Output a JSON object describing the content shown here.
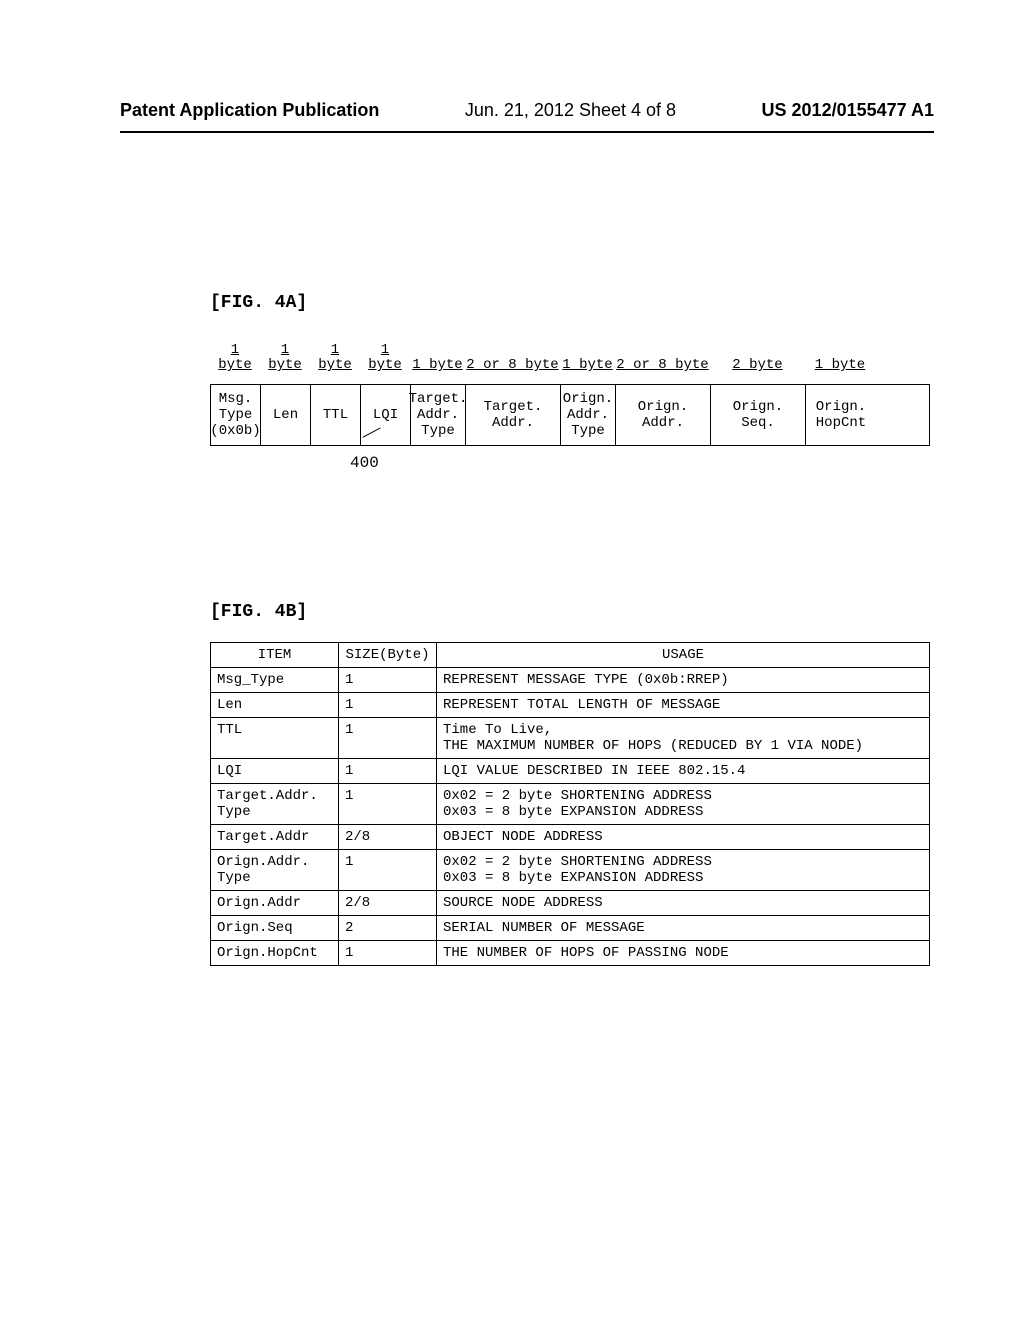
{
  "header": {
    "left": "Patent Application Publication",
    "center": "Jun. 21, 2012  Sheet 4 of 8",
    "right": "US 2012/0155477 A1"
  },
  "fig4a": {
    "label": "[FIG. 4A]",
    "byte_widths": [
      "1 byte",
      "1 byte",
      "1 byte",
      "1 byte",
      "1 byte",
      "2 or 8 byte",
      "1 byte",
      "2 or 8 byte",
      "2 byte",
      "1 byte"
    ],
    "fields": [
      "Msg.\nType\n(0x0b)",
      "Len",
      "TTL",
      "LQI",
      "Target.\nAddr.\nType",
      "Target.\nAddr.",
      "Orign.\nAddr.\nType",
      "Orign.\nAddr.",
      "Orign.\nSeq.",
      "Orign.\nHopCnt"
    ],
    "ref": "400"
  },
  "fig4b": {
    "label": "[FIG. 4B]",
    "headers": [
      "ITEM",
      "SIZE(Byte)",
      "USAGE"
    ],
    "rows": [
      {
        "item": "Msg_Type",
        "size": "1",
        "usage": "REPRESENT MESSAGE TYPE (0x0b:RREP)"
      },
      {
        "item": "Len",
        "size": "1",
        "usage": "REPRESENT TOTAL LENGTH OF MESSAGE"
      },
      {
        "item": "TTL",
        "size": "1",
        "usage": "Time To Live,\nTHE MAXIMUM NUMBER OF HOPS (REDUCED BY 1 VIA NODE)"
      },
      {
        "item": "LQI",
        "size": "1",
        "usage": "LQI VALUE DESCRIBED IN IEEE 802.15.4"
      },
      {
        "item": "Target.Addr.\nType",
        "size": "1",
        "usage": "0x02 = 2 byte SHORTENING ADDRESS\n0x03 = 8 byte EXPANSION ADDRESS"
      },
      {
        "item": "Target.Addr",
        "size": "2/8",
        "usage": "OBJECT NODE ADDRESS"
      },
      {
        "item": "Orign.Addr.\nType",
        "size": "1",
        "usage": "0x02 = 2 byte SHORTENING ADDRESS\n0x03 = 8 byte EXPANSION ADDRESS"
      },
      {
        "item": "Orign.Addr",
        "size": "2/8",
        "usage": "SOURCE NODE ADDRESS"
      },
      {
        "item": "Orign.Seq",
        "size": "2",
        "usage": "SERIAL NUMBER OF MESSAGE"
      },
      {
        "item": "Orign.HopCnt",
        "size": "1",
        "usage": "THE NUMBER OF HOPS OF PASSING NODE"
      }
    ]
  }
}
